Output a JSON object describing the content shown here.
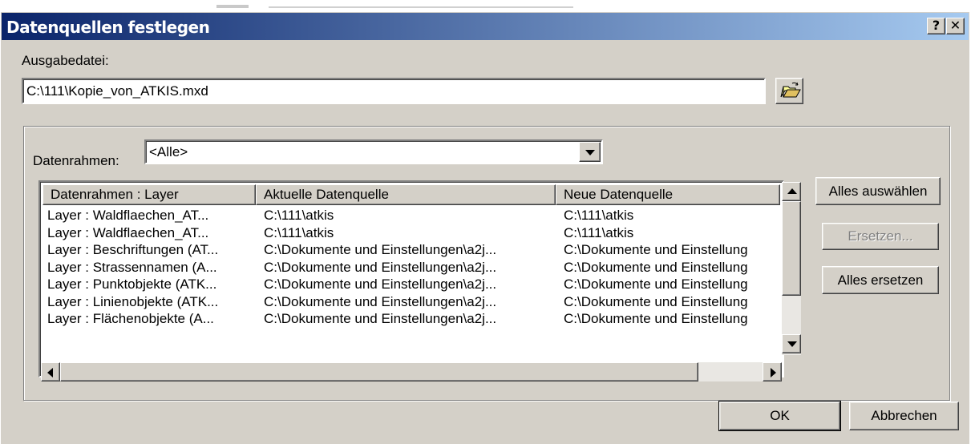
{
  "dialog": {
    "title": "Datenquellen festlegen",
    "help_label": "?",
    "close_label": "✕"
  },
  "output": {
    "label": "Ausgabedatei:",
    "value": "C:\\111\\Kopie_von_ATKIS.mxd",
    "browse_icon": "open-folder-icon"
  },
  "dataframe": {
    "label": "Datenrahmen:",
    "selected": "<Alle>"
  },
  "table": {
    "columns": [
      "Datenrahmen : Layer",
      "Aktuelle Datenquelle",
      "Neue Datenquelle"
    ],
    "rows": [
      [
        "Layer : Waldflaechen_AT...",
        "C:\\111\\atkis",
        "C:\\111\\atkis"
      ],
      [
        "Layer : Waldflaechen_AT...",
        "C:\\111\\atkis",
        "C:\\111\\atkis"
      ],
      [
        "Layer : Beschriftungen (AT...",
        "C:\\Dokumente und Einstellungen\\a2j...",
        "C:\\Dokumente und Einstellung"
      ],
      [
        "Layer : Strassennamen (A...",
        "C:\\Dokumente und Einstellungen\\a2j...",
        "C:\\Dokumente und Einstellung"
      ],
      [
        "Layer : Punktobjekte (ATK...",
        "C:\\Dokumente und Einstellungen\\a2j...",
        "C:\\Dokumente und Einstellung"
      ],
      [
        "Layer : Linienobjekte (ATK...",
        "C:\\Dokumente und Einstellungen\\a2j...",
        "C:\\Dokumente und Einstellung"
      ],
      [
        "Layer : Flächenobjekte (A...",
        "C:\\Dokumente und Einstellungen\\a2j...",
        "C:\\Dokumente und Einstellung"
      ]
    ]
  },
  "side_buttons": {
    "select_all": "Alles auswählen",
    "replace": "Ersetzen...",
    "replace_all": "Alles ersetzen"
  },
  "footer": {
    "ok": "OK",
    "cancel": "Abbrechen"
  }
}
